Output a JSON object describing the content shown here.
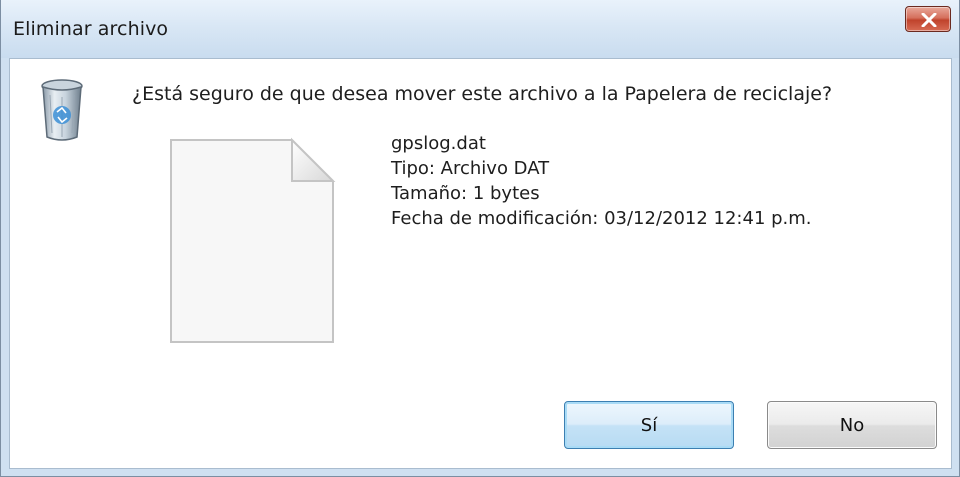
{
  "window": {
    "title": "Eliminar archivo"
  },
  "message": {
    "question": "¿Está seguro de que desea mover este archivo a la Papelera de reciclaje?"
  },
  "file": {
    "name": "gpslog.dat",
    "type": "Tipo: Archivo DAT",
    "size": "Tamaño: 1 bytes",
    "modified": "Fecha de modificación: 03/12/2012 12:41 p.m."
  },
  "buttons": {
    "yes_label": "Sí",
    "no_label": "No"
  },
  "icons": {
    "close": "close-icon",
    "recycle_bin": "recycle-bin-icon",
    "file": "file-icon"
  },
  "colors": {
    "close_button": "#c9472f",
    "yes_button_border": "#3c7fb1",
    "titlebar": "#d9e7f5"
  }
}
